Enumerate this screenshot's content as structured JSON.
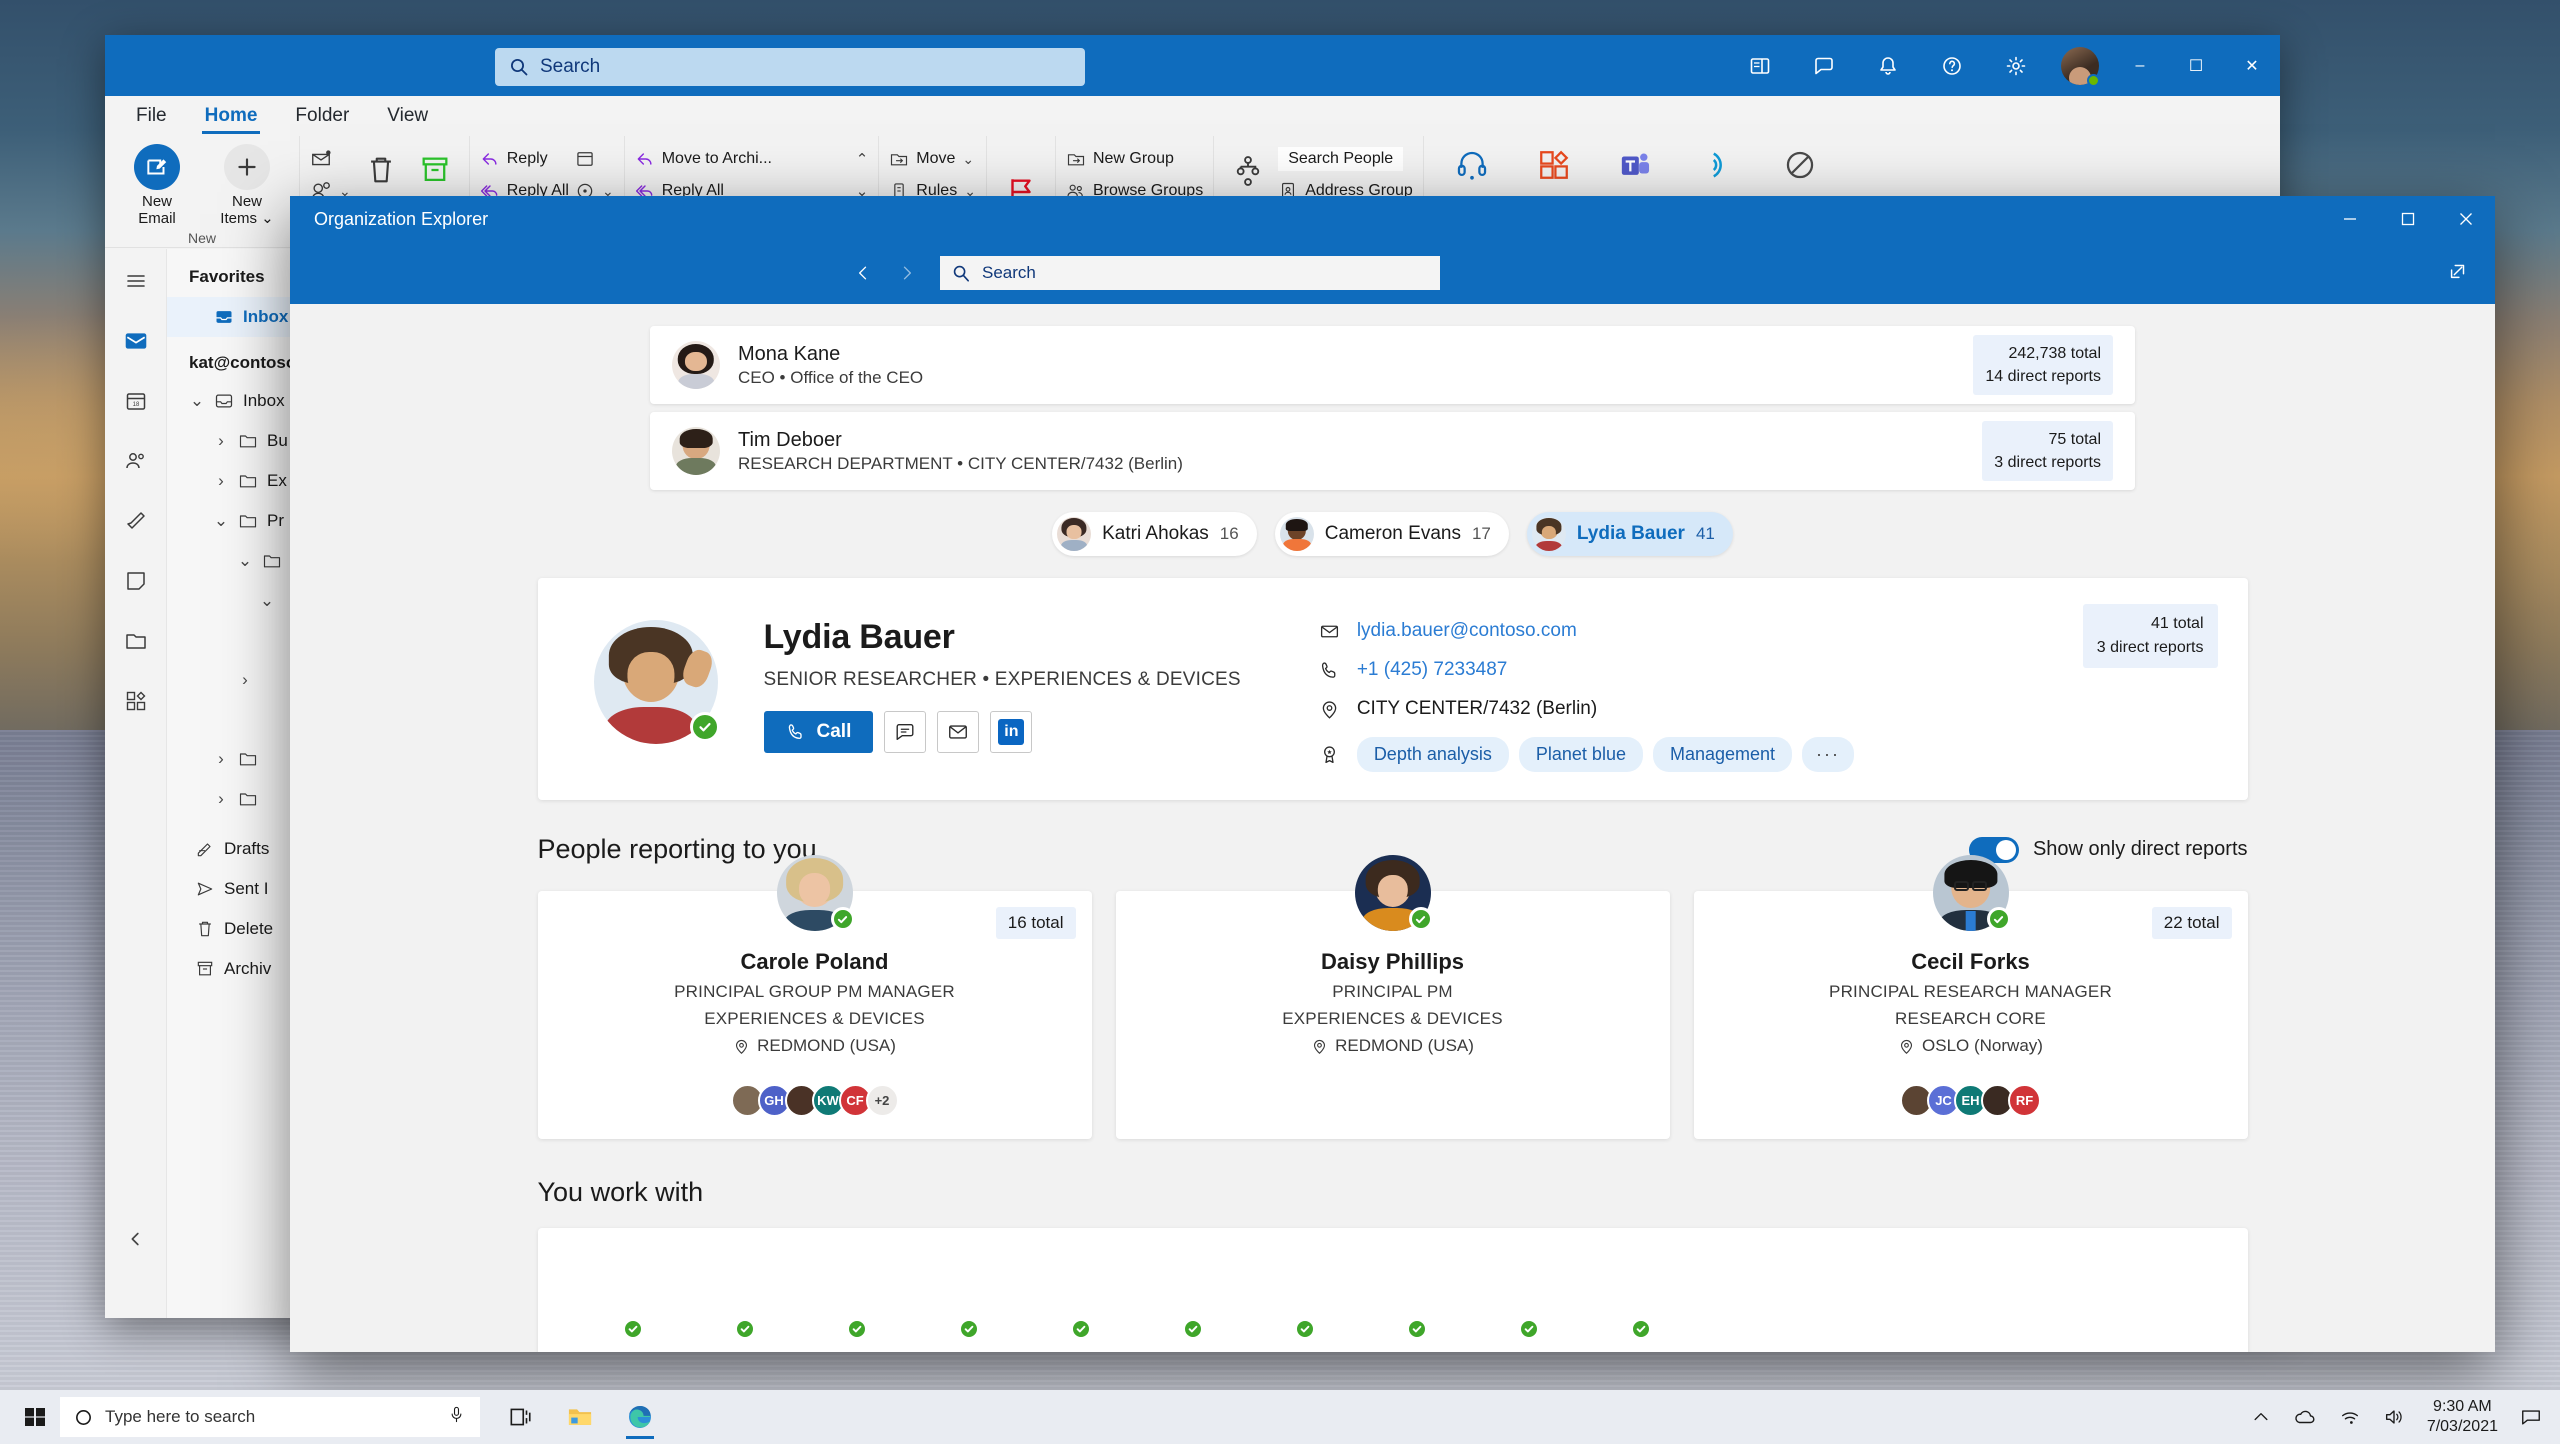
{
  "desktop": {
    "wallpaper_name": "windows-dunes-wallpaper"
  },
  "outlook": {
    "search": {
      "placeholder": "Search",
      "icon": "search-icon"
    },
    "titlebar_icons": [
      "reading-pane-icon",
      "chat-icon",
      "bell-icon",
      "help-icon",
      "gear-icon"
    ],
    "window_controls": {
      "minimize": "–",
      "maximize": "☐",
      "close": "✕"
    },
    "tabs": [
      {
        "label": "File",
        "active": false
      },
      {
        "label": "Home",
        "active": true
      },
      {
        "label": "Folder",
        "active": false
      },
      {
        "label": "View",
        "active": false
      }
    ],
    "ribbon": {
      "groups": [
        {
          "name": "New",
          "label": "New",
          "big": [
            {
              "label": "New\nEmail",
              "label1": "New",
              "label2": "Email",
              "icon": "new-email-icon"
            },
            {
              "label": "New\nItems",
              "label1": "New",
              "label2": "Items ⌄",
              "icon": "plus-icon"
            }
          ]
        },
        {
          "name": "Delete",
          "label": "",
          "small": [
            {
              "label": "",
              "icon": "ignore-icon"
            },
            {
              "label": "",
              "icon": "junk-icon"
            },
            {
              "label": "",
              "icon": "clean-up-icon"
            }
          ],
          "icons": [
            "delete-icon",
            "archive-icon"
          ]
        },
        {
          "name": "Respond",
          "label": "",
          "small": [
            {
              "label": "Reply",
              "icon": "reply-icon"
            },
            {
              "label": "Reply All",
              "icon": "reply-all-icon"
            }
          ],
          "icons": [
            "meeting-icon",
            "more-respond-icon"
          ]
        },
        {
          "name": "QuickSteps",
          "label": "",
          "small": [
            {
              "label": "Move to Archi...",
              "icon": "reply-icon"
            },
            {
              "label": "Reply All",
              "icon": "reply-all-icon"
            }
          ]
        },
        {
          "name": "Move",
          "label": "",
          "small": [
            {
              "label": "Move",
              "icon": "move-icon"
            },
            {
              "label": "Rules",
              "icon": "rules-icon"
            }
          ]
        },
        {
          "name": "Tags",
          "label": "",
          "icons": [
            "flag-icon"
          ]
        },
        {
          "name": "Groups",
          "label": "",
          "small": [
            {
              "label": "New Group",
              "icon": "new-group-icon"
            },
            {
              "label": "Browse Groups",
              "icon": "browse-groups-icon"
            }
          ]
        },
        {
          "name": "Find",
          "label": "",
          "small": [
            {
              "label": "Search People",
              "icon": "org-chart-icon"
            },
            {
              "label": "Address Group",
              "icon": "address-book-icon"
            }
          ]
        },
        {
          "name": "Speech",
          "label": "",
          "med": [
            {
              "label": "",
              "icon": "headset-icon"
            },
            {
              "label": "",
              "icon": "get-addins-icon"
            },
            {
              "label": "",
              "icon": "teams-icon"
            },
            {
              "label": "",
              "icon": "insights-icon"
            },
            {
              "label": "",
              "icon": "report-icon"
            }
          ]
        }
      ]
    },
    "rail": [
      {
        "icon": "hamburger-icon",
        "name": "menu",
        "active": false
      },
      {
        "icon": "mail-icon",
        "name": "mail",
        "active": true
      },
      {
        "icon": "calendar-icon",
        "name": "calendar",
        "active": false
      },
      {
        "icon": "people-icon",
        "name": "people",
        "active": false
      },
      {
        "icon": "tasks-icon",
        "name": "tasks",
        "active": false
      },
      {
        "icon": "notes-icon",
        "name": "notes",
        "active": false
      },
      {
        "icon": "folders-icon",
        "name": "folders",
        "active": false
      },
      {
        "icon": "addins-icon",
        "name": "add-ins",
        "active": false
      }
    ],
    "folders": {
      "favorites_header": "Favorites",
      "favorites": [
        {
          "label": "Inbox",
          "icon": "inbox-icon",
          "selected": true
        }
      ],
      "account": "kat@contoso...",
      "tree": [
        {
          "label": "Inbox",
          "icon": "inbox-icon",
          "chevron": "down",
          "indent": 0
        },
        {
          "label": "Bu",
          "icon": "folder-icon",
          "chevron": "right",
          "indent": 1
        },
        {
          "label": "Ex",
          "icon": "folder-icon",
          "chevron": "right",
          "indent": 1
        },
        {
          "label": "Pr",
          "icon": "folder-icon",
          "chevron": "down",
          "indent": 1
        },
        {
          "label": "",
          "icon": "folder-icon",
          "chevron": "down",
          "indent": 2
        },
        {
          "label": "",
          "icon": "",
          "chevron": "down",
          "indent": 3
        },
        {
          "label": "",
          "icon": "",
          "chevron": "right",
          "indent": 2
        },
        {
          "label": "",
          "icon": "folder-icon",
          "chevron": "right",
          "indent": 1
        },
        {
          "label": "",
          "icon": "folder-icon",
          "chevron": "right",
          "indent": 1
        },
        {
          "label": "Drafts",
          "icon": "drafts-icon",
          "chevron": "",
          "indent": 0
        },
        {
          "label": "Sent I",
          "icon": "sent-icon",
          "chevron": "",
          "indent": 0
        },
        {
          "label": "Delete",
          "icon": "deleted-icon",
          "chevron": "",
          "indent": 0
        },
        {
          "label": "Archiv",
          "icon": "archive-icon",
          "chevron": "",
          "indent": 0
        }
      ],
      "collapse_icon": "chevron-left-icon"
    }
  },
  "org_explorer": {
    "window_title": "Organization Explorer",
    "window_controls": {
      "minimize": "–",
      "maximize": "☐",
      "close": "✕"
    },
    "nav": {
      "back_icon": "chevron-left-icon",
      "forward_icon": "chevron-right-icon",
      "search_placeholder": "Search",
      "search_icon": "search-icon",
      "popout_icon": "popout-icon"
    },
    "chain": [
      {
        "name": "Mona Kane",
        "subtitle": "CEO • Office of the CEO",
        "total": "242,738 total",
        "direct_reports": "14 direct reports",
        "avatar_name": "mona-kane-avatar",
        "hair": "#241a16",
        "skin": "#e4b793"
      },
      {
        "name": "Tim Deboer",
        "subtitle": "RESEARCH DEPARTMENT • CITY CENTER/7432 (Berlin)",
        "total": "75 total",
        "direct_reports": "3 direct reports",
        "avatar_name": "tim-deboer-avatar",
        "hair": "#2d2018",
        "skin": "#d8a880"
      }
    ],
    "peers": [
      {
        "name": "Katri Ahokas",
        "count": "16",
        "selected": false,
        "hair": "#3b2a24",
        "skin": "#e8c0a0"
      },
      {
        "name": "Cameron Evans",
        "count": "17",
        "selected": false,
        "hair": "#1e1512",
        "skin": "#6d4328"
      },
      {
        "name": "Lydia Bauer",
        "count": "41",
        "selected": true,
        "hair": "#4a3524",
        "skin": "#d9a878"
      }
    ],
    "profile": {
      "name": "Lydia Bauer",
      "title": "SENIOR RESEARCHER • EXPERIENCES & DEVICES",
      "presence": "available",
      "actions": {
        "call_label": "Call",
        "call_icon": "phone-icon",
        "chat_icon": "chat-icon",
        "mail_icon": "mail-icon",
        "linkedin_icon": "linkedin-icon",
        "linkedin_label": "in"
      },
      "contact": {
        "email": "lydia.bauer@contoso.com",
        "email_icon": "mail-icon",
        "phone": "+1 (425) 7233487",
        "phone_icon": "phone-icon",
        "location": "CITY CENTER/7432 (Berlin)",
        "location_icon": "location-pin-icon",
        "skills_icon": "badge-icon",
        "skills": [
          "Depth analysis",
          "Planet blue",
          "Management"
        ],
        "skills_more": "···"
      },
      "stats": {
        "total": "41 total",
        "direct_reports": "3 direct reports"
      }
    },
    "reports_section": {
      "title": "People reporting to you",
      "toggle": {
        "label": "Show only direct reports",
        "on": true,
        "color": "#0f6cbd"
      },
      "cards": [
        {
          "name": "Carole Poland",
          "role": "PRINCIPAL GROUP PM MANAGER",
          "org": "EXPERIENCES & DEVICES",
          "location": "REDMOND (USA)",
          "location_icon": "location-pin-icon",
          "total": "16 total",
          "presence": "available",
          "hair": "#d8c08a",
          "skin": "#edc4a4",
          "stack": [
            {
              "type": "photo",
              "color": "#7e6a55",
              "initials": ""
            },
            {
              "type": "initials",
              "color": "#4e61c8",
              "initials": "GH"
            },
            {
              "type": "photo",
              "color": "#4a3226",
              "initials": ""
            },
            {
              "type": "initials",
              "color": "#0f7a76",
              "initials": "KW"
            },
            {
              "type": "initials",
              "color": "#d13438",
              "initials": "CF"
            },
            {
              "type": "plus",
              "color": "#edebe9",
              "initials": "+2"
            }
          ]
        },
        {
          "name": "Daisy Phillips",
          "role": "PRINCIPAL PM",
          "org": "EXPERIENCES & DEVICES",
          "location": "REDMOND (USA)",
          "location_icon": "location-pin-icon",
          "total": "",
          "presence": "available",
          "hair": "#3c2a1e",
          "skin": "#e8bd9c",
          "stack": []
        },
        {
          "name": "Cecil Forks",
          "role": "PRINCIPAL RESEARCH MANAGER",
          "org": "RESEARCH CORE",
          "location": "OSLO (Norway)",
          "location_icon": "location-pin-icon",
          "total": "22 total",
          "presence": "available",
          "hair": "#151515",
          "skin": "#e3b48c",
          "stack": [
            {
              "type": "photo",
              "color": "#5b4433",
              "initials": ""
            },
            {
              "type": "initials",
              "color": "#5b6fd6",
              "initials": "JC"
            },
            {
              "type": "initials",
              "color": "#0f7a76",
              "initials": "EH"
            },
            {
              "type": "photo",
              "color": "#3a2a22",
              "initials": ""
            },
            {
              "type": "initials",
              "color": "#d13438",
              "initials": "RF"
            }
          ]
        }
      ]
    },
    "work_with_section": {
      "title": "You work with",
      "people": [
        {
          "name": "person-1",
          "hair": "#4a3728",
          "skin": "#e8c3a2"
        },
        {
          "name": "person-2",
          "hair": "#2b1d14",
          "skin": "#caa079"
        },
        {
          "name": "person-3",
          "hair": "#1d1710",
          "skin": "#c99a6e"
        },
        {
          "name": "person-4",
          "hair": "#140f0c",
          "skin": "#7a5132"
        },
        {
          "name": "person-5",
          "hair": "#2a2220",
          "skin": "#cfa37b"
        },
        {
          "name": "person-6",
          "hair": "#c8a86e",
          "skin": "#f0d0b4"
        },
        {
          "name": "person-7",
          "hair": "#17110e",
          "skin": "#6b4526"
        },
        {
          "name": "person-8",
          "hair": "#3b2b20",
          "skin": "#b68a60"
        },
        {
          "name": "person-9",
          "hair": "#151010",
          "skin": "#e2bb98"
        },
        {
          "name": "person-10",
          "hair": "#2e2422",
          "skin": "#d4ab86"
        }
      ]
    }
  },
  "taskbar": {
    "start_icon": "windows-start-icon",
    "search": {
      "placeholder": "Type here to search",
      "icon": "cortana-circle-icon",
      "mic_icon": "microphone-icon"
    },
    "pinned": [
      {
        "name": "task-view-icon",
        "label": ""
      },
      {
        "name": "file-explorer-icon",
        "label": ""
      },
      {
        "name": "microsoft-edge-icon",
        "label": ""
      }
    ],
    "tray": {
      "chevron_icon": "show-hidden-icons-icon",
      "onedrive_icon": "onedrive-icon",
      "network_icon": "wifi-icon",
      "volume_icon": "volume-icon",
      "time": "9:30 AM",
      "date": "7/03/2021",
      "action_center_icon": "action-center-icon"
    }
  }
}
